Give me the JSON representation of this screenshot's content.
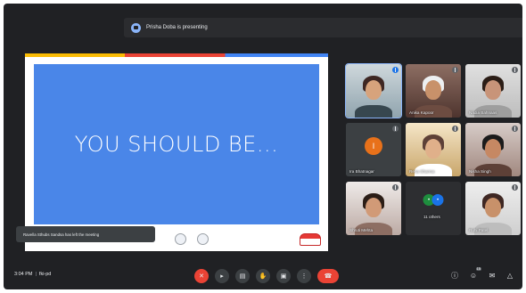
{
  "banner": {
    "text": "Prisha Doba is presenting"
  },
  "slide": {
    "title": "YOU SHOULD BE..."
  },
  "toast": {
    "text": "Ravella Sthubs Sandsa has left the meeting"
  },
  "tiles": [
    {
      "name": "",
      "mic": "active"
    },
    {
      "name": "Anika Kapoor",
      "mic": "muted"
    },
    {
      "name": "Nadia Bahnaas",
      "mic": "muted"
    },
    {
      "name": "Ira Bhatnagar",
      "avatar": "I",
      "mic": "muted"
    },
    {
      "name": "Rena Sharma",
      "mic": "muted"
    },
    {
      "name": "Nisha Singh",
      "mic": "muted"
    },
    {
      "name": "Shruti Mehta",
      "mic": "muted"
    },
    {
      "name": "11 others",
      "mic": "none"
    },
    {
      "name": "Ruhi Patel",
      "mic": "muted"
    }
  ],
  "bottom": {
    "time": "3:04 PM",
    "meeting_code": "fki-pd",
    "controls": [
      "mic-off",
      "camera",
      "captions",
      "raise-hand",
      "present",
      "more",
      "leave"
    ],
    "right": [
      "info",
      "people",
      "chat",
      "activities"
    ],
    "people_count": "15"
  }
}
